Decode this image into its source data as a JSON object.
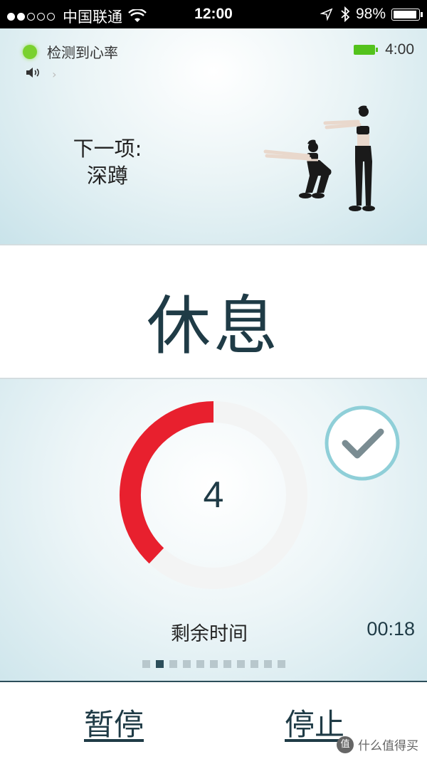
{
  "status_bar": {
    "carrier": "中国联通",
    "time": "12:00",
    "battery_percent": "98%",
    "signal_bars_filled": 2,
    "signal_bars_total": 5
  },
  "top": {
    "heart_rate_status": "检测到心率",
    "heart_rate_indicator_color": "#7ad12e",
    "battery_time": "4:00",
    "next_label": "下一项:",
    "next_exercise": "深蹲"
  },
  "main": {
    "title": "休息"
  },
  "timer": {
    "countdown_value": "4",
    "progress_fraction": 0.38,
    "progress_color": "#e8202e",
    "remaining_label": "剩余时间",
    "remaining_time": "00:18",
    "pages_total": 11,
    "pages_active_index": 1
  },
  "footer": {
    "pause_label": "暂停",
    "stop_label": "停止"
  },
  "watermark": {
    "text": "什么值得买",
    "logo_char": "值"
  }
}
